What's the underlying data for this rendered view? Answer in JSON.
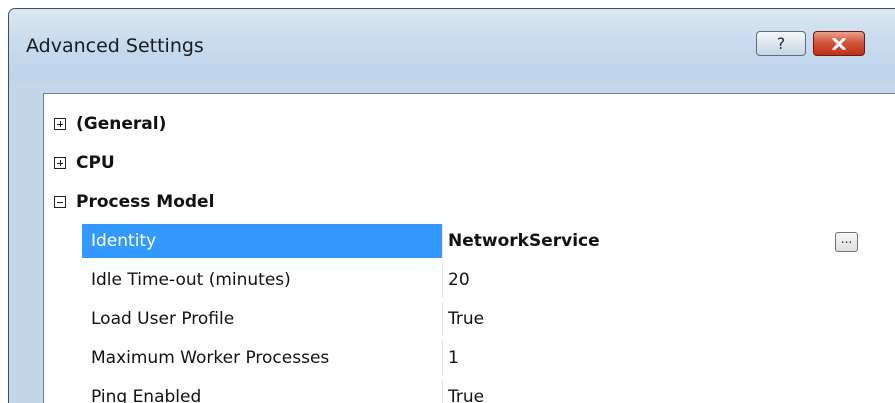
{
  "window": {
    "title": "Advanced Settings",
    "help_glyph": "?",
    "close_glyph": "✕",
    "close_color": "#c9391e"
  },
  "grid": {
    "categories": [
      {
        "label": "(General)",
        "expanded": false,
        "expander_glyph": "plus-icon"
      },
      {
        "label": "CPU",
        "expanded": false,
        "expander_glyph": "plus-icon"
      },
      {
        "label": "Process Model",
        "expanded": true,
        "expander_glyph": "minus-icon"
      }
    ],
    "properties": [
      {
        "name": "Identity",
        "value": "NetworkService",
        "selected": true,
        "bold_value": true,
        "has_browse_button": true,
        "browse_label": "..."
      },
      {
        "name": "Idle Time-out (minutes)",
        "value": "20"
      },
      {
        "name": "Load User Profile",
        "value": "True"
      },
      {
        "name": "Maximum Worker Processes",
        "value": "1"
      },
      {
        "name": "Ping Enabled",
        "value": "True"
      }
    ],
    "selection_color": "#3399ff"
  }
}
